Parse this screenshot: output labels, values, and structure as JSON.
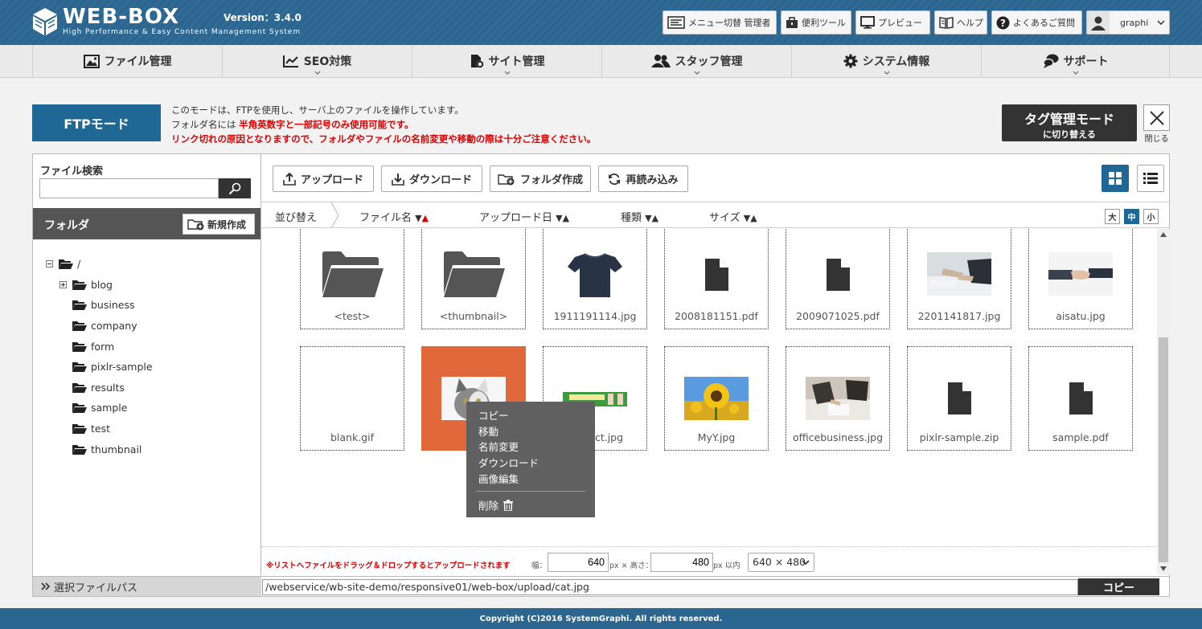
{
  "header": {
    "logo": "WEB-BOX",
    "tagline": "High Performance & Easy Content Management System",
    "version": "Version：3.4.0",
    "buttons": {
      "menu_switch": "メニュー切替 管理者",
      "tools": "便利ツール",
      "preview": "プレビュー",
      "help": "ヘルプ",
      "faq": "よくあるご質問"
    },
    "user": "graphi"
  },
  "nav": {
    "file": "ファイル管理",
    "seo": "SEO対策",
    "site": "サイト管理",
    "staff": "スタッフ管理",
    "system": "システム情報",
    "support": "サポート"
  },
  "mode": {
    "ftp_label": "FTPモード",
    "line1": "このモードは、FTPを使用し、サーバ上のファイルを操作しています。",
    "line2_a": "フォルダ名には",
    "line2_b": "半角英数字と一部記号のみ使用可能です。",
    "line3": "リンク切れの原因となりますので、フォルダやファイルの名前変更や移動の際は十分ご注意ください。",
    "tag_title": "タグ管理モード",
    "tag_sub": "に切り替える",
    "close_label": "閉じる"
  },
  "sidebar": {
    "search_label": "ファイル検索",
    "search_value": "",
    "folder_label": "フォルダ",
    "new_button": "新規作成",
    "tree": [
      "/",
      "blog",
      "business",
      "company",
      "form",
      "pixlr-sample",
      "results",
      "sample",
      "test",
      "thumbnail"
    ]
  },
  "toolbar": {
    "upload": "アップロード",
    "download": "ダウンロード",
    "new_folder": "フォルダ作成",
    "reload": "再読み込み"
  },
  "sort": {
    "label": "並び替え",
    "filename": "ファイル名",
    "upload_date": "アップロード日",
    "kind": "種類",
    "size": "サイズ",
    "arrow_down": "▼",
    "arrow_up": "▲",
    "size_large": "大",
    "size_medium": "中",
    "size_small": "小"
  },
  "files": [
    "<test>",
    "<thumbnail>",
    "1911191114.jpg",
    "2008181151.pdf",
    "2009071025.pdf",
    "2201141817.jpg",
    "aisatu.jpg",
    "blank.gif",
    "cat.jpg",
    "contact.jpg",
    "MyY.jpg",
    "officebusiness.jpg",
    "pixlr-sample.zip",
    "sample.pdf"
  ],
  "selected_file_display": "cat",
  "context_menu": {
    "copy": "コピー",
    "move": "移動",
    "rename": "名前変更",
    "download": "ダウンロード",
    "edit_image": "画像編集",
    "delete": "削除"
  },
  "bottom": {
    "note": "※リストへファイルをドラッグ＆ドロップするとアップロードされます",
    "width_label": "幅：",
    "width_value": "640",
    "px_x_height": "px × 高さ：",
    "height_value": "480",
    "px_within": "px 以内",
    "size_select": "640 × 480"
  },
  "pathbar": {
    "label": "選択ファイルパス",
    "path": "/webservice/wb-site-demo/responsive01/web-box/upload/cat.jpg",
    "copy": "コピー"
  },
  "footer": "Copyright (C)2016 SystemGraphi. All rights reserved.",
  "colors": {
    "header": "#2a6690",
    "accent": "#1f6896",
    "selected": "#e0683a",
    "warning": "#dd0000"
  }
}
